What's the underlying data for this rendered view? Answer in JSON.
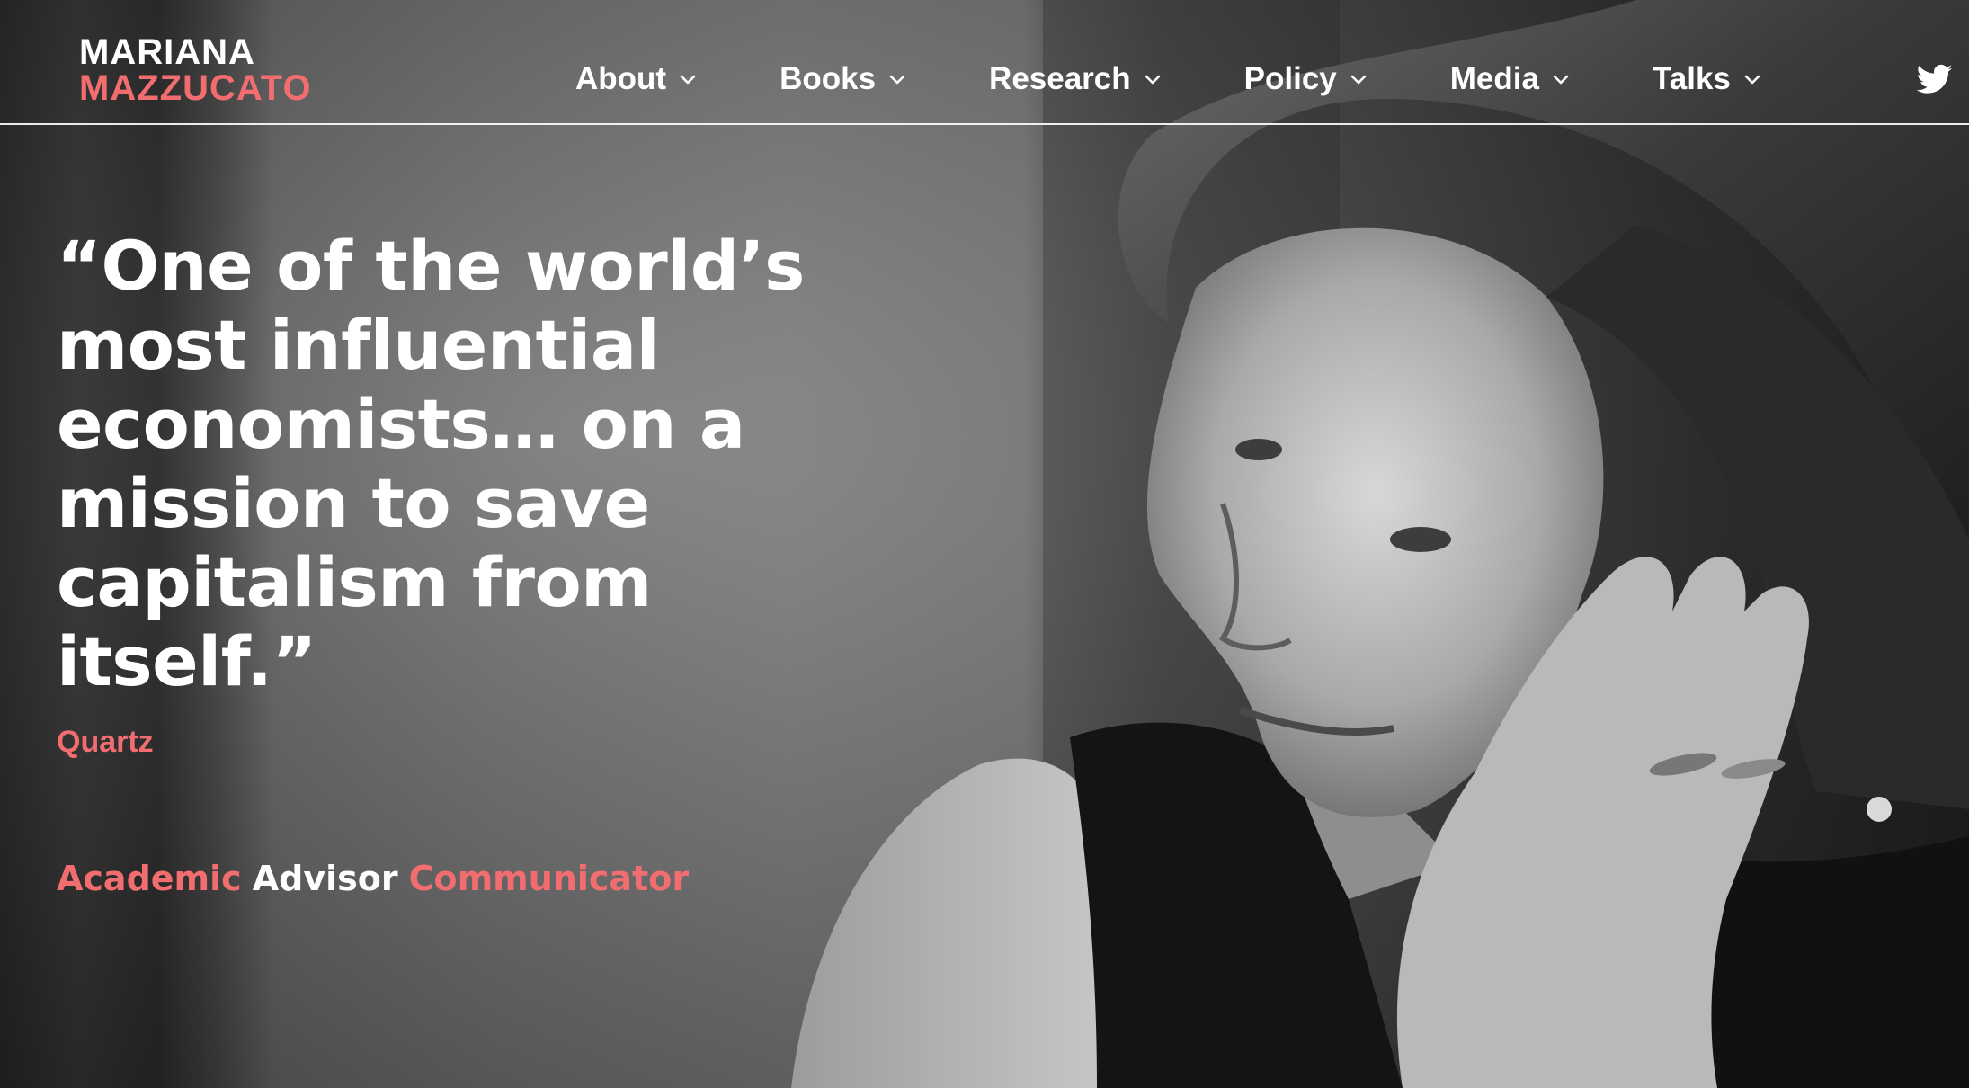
{
  "header": {
    "logo": {
      "line1": "MARIANA",
      "line2": "MAZZUCATO"
    },
    "nav": [
      {
        "label": "About"
      },
      {
        "label": "Books"
      },
      {
        "label": "Research"
      },
      {
        "label": "Policy"
      },
      {
        "label": "Media"
      },
      {
        "label": "Talks"
      }
    ],
    "social": {
      "icon": "twitter-icon"
    }
  },
  "hero": {
    "quote": "“One of the world’s most influential economists… on a mission to save capitalism from itself.”",
    "source": "Quartz",
    "roles": [
      "Academic",
      "Advisor",
      "Communicator"
    ]
  },
  "colors": {
    "accent": "#f26d70",
    "text": "#ffffff"
  }
}
